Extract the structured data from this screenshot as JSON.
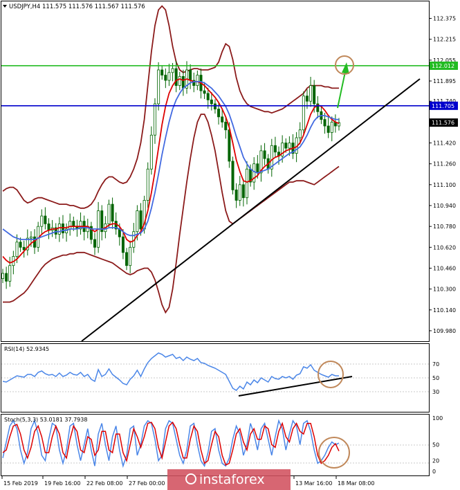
{
  "chart_data": [
    {
      "type": "candlestick",
      "title": "USDJPY,H4  111.575 111.576 111.567 111.576",
      "ylim": [
        109.9,
        112.5
      ],
      "y_ticks": [
        "112.375",
        "112.215",
        "112.055",
        "111.895",
        "111.740",
        "111.580",
        "111.420",
        "111.260",
        "111.100",
        "110.940",
        "110.780",
        "110.620",
        "110.460",
        "110.300",
        "110.140",
        "109.980"
      ],
      "x_ticks": [
        "15 Feb 2019",
        "19 Feb 16:00",
        "22 Feb 08:00",
        "27 Feb 00:00",
        "13 Mar 16:00",
        "18 Mar 08:00"
      ],
      "price_tags": [
        {
          "label": "112.012",
          "value": 112.012,
          "color": "#22bb22"
        },
        {
          "label": "111.705",
          "value": 111.705,
          "color": "#0000cc"
        },
        {
          "label": "111.576",
          "value": 111.576,
          "color": "#000000"
        }
      ],
      "closes": [
        110.42,
        110.36,
        110.48,
        110.55,
        110.66,
        110.62,
        110.6,
        110.69,
        110.7,
        110.62,
        110.78,
        110.86,
        110.8,
        110.75,
        110.77,
        110.72,
        110.8,
        110.73,
        110.76,
        110.82,
        110.78,
        110.76,
        110.82,
        110.74,
        110.78,
        110.68,
        110.62,
        110.9,
        110.74,
        110.8,
        110.95,
        110.82,
        110.76,
        110.7,
        110.58,
        110.48,
        110.62,
        110.74,
        110.9,
        110.76,
        110.98,
        111.22,
        111.48,
        111.72,
        111.98,
        111.94,
        111.9,
        111.96,
        111.99,
        111.86,
        111.93,
        111.84,
        111.98,
        111.9,
        111.86,
        111.94,
        111.82,
        111.8,
        111.75,
        111.72,
        111.68,
        111.62,
        111.58,
        111.52,
        111.28,
        111.06,
        110.98,
        111.1,
        111.0,
        111.22,
        111.12,
        111.26,
        111.19,
        111.36,
        111.3,
        111.22,
        111.4,
        111.35,
        111.32,
        111.42,
        111.38,
        111.42,
        111.34,
        111.46,
        111.52,
        111.78,
        111.74,
        111.86,
        111.72,
        111.66,
        111.6,
        111.55,
        111.5,
        111.58,
        111.55,
        111.576
      ],
      "series": [
        {
          "name": "Moving Average (red)",
          "color": "#dd0000",
          "values": [
            110.55,
            110.52,
            110.5,
            110.51,
            110.53,
            110.56,
            110.59,
            110.62,
            110.65,
            110.67,
            110.69,
            110.72,
            110.74,
            110.75,
            110.76,
            110.76,
            110.77,
            110.77,
            110.77,
            110.78,
            110.78,
            110.78,
            110.78,
            110.78,
            110.78,
            110.76,
            110.74,
            110.76,
            110.76,
            110.77,
            110.79,
            110.8,
            110.8,
            110.78,
            110.74,
            110.68,
            110.66,
            110.67,
            110.71,
            110.74,
            110.8,
            110.9,
            111.04,
            111.2,
            111.38,
            111.56,
            111.7,
            111.8,
            111.86,
            111.9,
            111.91,
            111.9,
            111.91,
            111.9,
            111.89,
            111.89,
            111.88,
            111.86,
            111.83,
            111.8,
            111.77,
            111.73,
            111.68,
            111.62,
            111.54,
            111.42,
            111.29,
            111.2,
            111.13,
            111.12,
            111.13,
            111.15,
            111.17,
            111.21,
            111.24,
            111.26,
            111.29,
            111.31,
            111.32,
            111.34,
            111.36,
            111.37,
            111.38,
            111.39,
            111.42,
            111.48,
            111.56,
            111.64,
            111.69,
            111.71,
            111.7,
            111.67,
            111.63,
            111.6,
            111.58,
            111.57
          ]
        },
        {
          "name": "Moving Average (blue)",
          "color": "#4169e1",
          "values": [
            110.76,
            110.74,
            110.72,
            110.7,
            110.69,
            110.68,
            110.68,
            110.68,
            110.68,
            110.68,
            110.69,
            110.7,
            110.71,
            110.72,
            110.73,
            110.74,
            110.74,
            110.75,
            110.75,
            110.76,
            110.76,
            110.76,
            110.77,
            110.77,
            110.77,
            110.76,
            110.76,
            110.76,
            110.76,
            110.76,
            110.77,
            110.77,
            110.77,
            110.76,
            110.74,
            110.72,
            110.71,
            110.71,
            110.72,
            110.73,
            110.76,
            110.82,
            110.92,
            111.04,
            111.18,
            111.33,
            111.46,
            111.58,
            111.68,
            111.75,
            111.8,
            111.84,
            111.86,
            111.88,
            111.89,
            111.89,
            111.89,
            111.88,
            111.86,
            111.84,
            111.81,
            111.78,
            111.74,
            111.7,
            111.64,
            111.56,
            111.47,
            111.39,
            111.31,
            111.26,
            111.22,
            111.2,
            111.19,
            111.2,
            111.21,
            111.22,
            111.24,
            111.26,
            111.28,
            111.3,
            111.32,
            111.34,
            111.35,
            111.37,
            111.39,
            111.43,
            111.48,
            111.54,
            111.59,
            111.62,
            111.63,
            111.63,
            111.62,
            111.61,
            111.6,
            111.6
          ]
        },
        {
          "name": "Bollinger Upper",
          "color": "#8b1a1a",
          "values": [
            111.05,
            111.07,
            111.08,
            111.08,
            111.06,
            111.02,
            110.98,
            110.96,
            110.97,
            110.99,
            111.0,
            111.0,
            110.99,
            110.98,
            110.97,
            110.96,
            110.95,
            110.95,
            110.95,
            110.94,
            110.94,
            110.93,
            110.92,
            110.92,
            110.93,
            110.95,
            110.99,
            111.05,
            111.1,
            111.14,
            111.16,
            111.16,
            111.14,
            111.12,
            111.11,
            111.12,
            111.16,
            111.22,
            111.3,
            111.42,
            111.6,
            111.86,
            112.12,
            112.32,
            112.44,
            112.47,
            112.44,
            112.32,
            112.16,
            112.04,
            111.98,
            111.96,
            111.97,
            111.98,
            111.99,
            111.99,
            111.98,
            111.98,
            111.98,
            111.99,
            112.0,
            112.04,
            112.12,
            112.18,
            112.16,
            112.06,
            111.92,
            111.82,
            111.76,
            111.72,
            111.7,
            111.69,
            111.68,
            111.67,
            111.66,
            111.66,
            111.65,
            111.66,
            111.67,
            111.68,
            111.7,
            111.72,
            111.74,
            111.76,
            111.78,
            111.8,
            111.84,
            111.86,
            111.86,
            111.86,
            111.86,
            111.85,
            111.85,
            111.84,
            111.84,
            111.84
          ]
        },
        {
          "name": "Bollinger Lower",
          "color": "#8b1a1a",
          "values": [
            110.2,
            110.2,
            110.2,
            110.21,
            110.23,
            110.25,
            110.27,
            110.3,
            110.34,
            110.38,
            110.42,
            110.46,
            110.49,
            110.51,
            110.53,
            110.54,
            110.55,
            110.56,
            110.56,
            110.57,
            110.57,
            110.58,
            110.58,
            110.58,
            110.57,
            110.56,
            110.55,
            110.54,
            110.53,
            110.52,
            110.51,
            110.5,
            110.48,
            110.46,
            110.44,
            110.42,
            110.41,
            110.42,
            110.44,
            110.45,
            110.46,
            110.46,
            110.43,
            110.37,
            110.28,
            110.18,
            110.12,
            110.16,
            110.3,
            110.5,
            110.72,
            110.92,
            111.12,
            111.3,
            111.46,
            111.58,
            111.64,
            111.64,
            111.58,
            111.48,
            111.36,
            111.2,
            111.04,
            110.9,
            110.82,
            110.8,
            110.82,
            110.84,
            110.86,
            110.88,
            110.9,
            110.92,
            110.94,
            110.96,
            110.98,
            111.0,
            111.02,
            111.04,
            111.06,
            111.08,
            111.1,
            111.12,
            111.12,
            111.13,
            111.13,
            111.13,
            111.12,
            111.11,
            111.1,
            111.12,
            111.14,
            111.16,
            111.18,
            111.2,
            111.22,
            111.24
          ]
        }
      ],
      "horizontal_lines": [
        {
          "value": 112.012,
          "color": "#22bb22"
        },
        {
          "value": 111.705,
          "color": "#0000cc"
        }
      ]
    },
    {
      "type": "line",
      "title": "RSI(14) 52.9345",
      "ylim": [
        0,
        100
      ],
      "y_ticks": [
        "70",
        "50",
        "30"
      ],
      "series": [
        {
          "name": "RSI",
          "color": "#4a86e8",
          "values": [
            45,
            44,
            47,
            50,
            53,
            52,
            51,
            55,
            55,
            52,
            58,
            60,
            56,
            54,
            55,
            52,
            57,
            52,
            54,
            58,
            55,
            54,
            58,
            52,
            55,
            48,
            45,
            62,
            52,
            55,
            63,
            55,
            51,
            47,
            42,
            40,
            48,
            53,
            61,
            52,
            63,
            72,
            78,
            82,
            86,
            84,
            80,
            82,
            84,
            78,
            80,
            75,
            80,
            77,
            75,
            78,
            72,
            71,
            68,
            66,
            64,
            61,
            58,
            55,
            45,
            35,
            32,
            38,
            34,
            44,
            40,
            47,
            43,
            50,
            47,
            44,
            52,
            49,
            48,
            52,
            50,
            52,
            48,
            54,
            56,
            66,
            64,
            69,
            61,
            58,
            55,
            53,
            51,
            55,
            53,
            53
          ]
        }
      ]
    },
    {
      "type": "line",
      "title": "Stoch(5,3,3) 53.0181 37.7938",
      "ylim": [
        0,
        100
      ],
      "y_ticks": [
        "100",
        "50",
        "20",
        "0"
      ],
      "series": [
        {
          "name": "%K",
          "color": "#4a86e8",
          "values": [
            25,
            55,
            85,
            95,
            80,
            40,
            15,
            35,
            80,
            95,
            70,
            30,
            20,
            60,
            90,
            85,
            40,
            15,
            40,
            85,
            90,
            50,
            20,
            50,
            80,
            40,
            10,
            70,
            90,
            50,
            20,
            65,
            85,
            40,
            10,
            30,
            80,
            85,
            30,
            50,
            85,
            95,
            90,
            60,
            20,
            30,
            80,
            95,
            90,
            60,
            30,
            15,
            40,
            85,
            90,
            50,
            20,
            10,
            35,
            75,
            80,
            40,
            15,
            10,
            25,
            60,
            85,
            70,
            30,
            50,
            90,
            70,
            40,
            80,
            90,
            60,
            30,
            65,
            95,
            80,
            40,
            70,
            95,
            85,
            50,
            90,
            95,
            75,
            40,
            15,
            20,
            30,
            45,
            55,
            50,
            53
          ]
        },
        {
          "name": "%D",
          "color": "#dd0000",
          "values": [
            35,
            40,
            65,
            85,
            88,
            70,
            40,
            25,
            45,
            75,
            85,
            65,
            35,
            35,
            65,
            85,
            70,
            35,
            25,
            60,
            85,
            75,
            40,
            35,
            65,
            60,
            30,
            40,
            75,
            75,
            40,
            35,
            70,
            70,
            35,
            20,
            50,
            80,
            65,
            45,
            65,
            90,
            92,
            80,
            45,
            25,
            55,
            85,
            92,
            80,
            50,
            25,
            25,
            60,
            85,
            75,
            40,
            15,
            20,
            50,
            75,
            65,
            30,
            12,
            15,
            40,
            70,
            80,
            55,
            40,
            70,
            80,
            60,
            60,
            85,
            80,
            50,
            45,
            75,
            90,
            65,
            55,
            80,
            90,
            75,
            70,
            90,
            90,
            65,
            30,
            15,
            20,
            30,
            45,
            52,
            38
          ]
        }
      ]
    }
  ],
  "watermark": {
    "text": "instaforex"
  }
}
